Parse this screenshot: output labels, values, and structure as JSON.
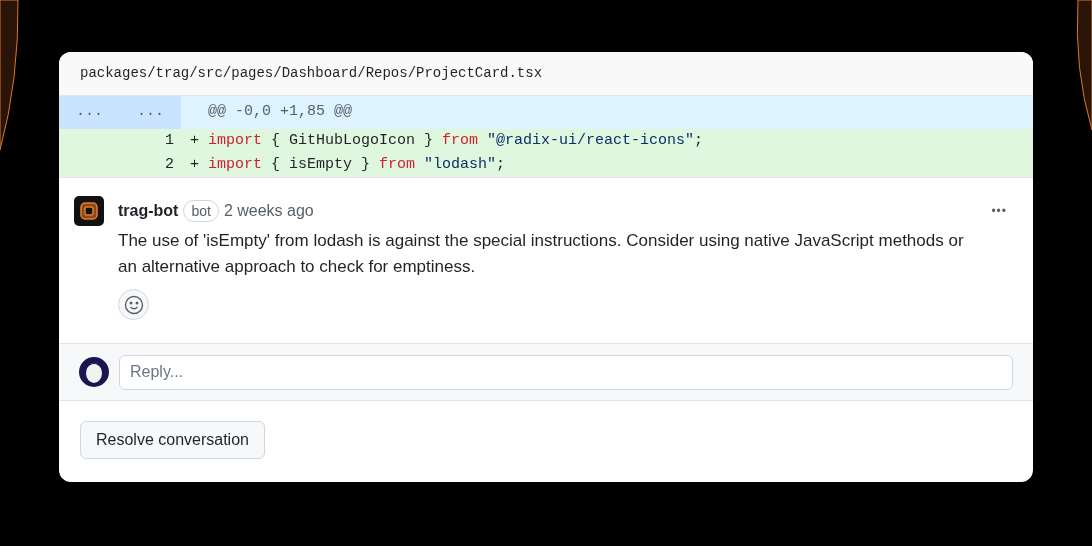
{
  "file": {
    "path": "packages/trag/src/pages/Dashboard/Repos/ProjectCard.tsx"
  },
  "hunk": {
    "old_number": "...",
    "new_number": "...",
    "text": "@@ -0,0 +1,85 @@"
  },
  "lines": [
    {
      "kind": "added",
      "new_number": "1",
      "sign": "+",
      "tokens": [
        {
          "kind": "keyword",
          "text": "import"
        },
        {
          "kind": "plain",
          "text": " { GitHubLogoIcon } "
        },
        {
          "kind": "keyword",
          "text": "from"
        },
        {
          "kind": "string",
          "text": " \"@radix-ui/react-icons\""
        },
        {
          "kind": "plain",
          "text": ";"
        }
      ]
    },
    {
      "kind": "added",
      "new_number": "2",
      "sign": "+",
      "tokens": [
        {
          "kind": "keyword",
          "text": "import"
        },
        {
          "kind": "plain",
          "text": " { isEmpty } "
        },
        {
          "kind": "keyword",
          "text": "from"
        },
        {
          "kind": "string",
          "text": " \"lodash\""
        },
        {
          "kind": "plain",
          "text": ";"
        }
      ]
    }
  ],
  "comment": {
    "author": "trag-bot",
    "badge": "bot",
    "time": "2 weeks ago",
    "menu": "•••",
    "body": "The use of 'isEmpty' from lodash is against the special instructions. Consider using native JavaScript methods or an alternative approach to check for emptiness."
  },
  "reply": {
    "placeholder": "Reply..."
  },
  "resolve_button": "Resolve conversation"
}
